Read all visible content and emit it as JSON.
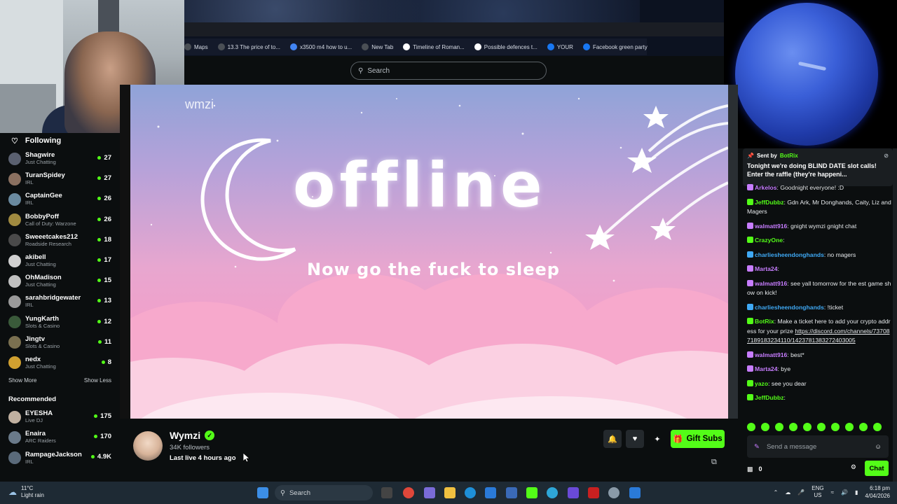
{
  "browser": {
    "bookmarks": [
      {
        "label": "Maps",
        "color": "#4a4f55"
      },
      {
        "label": "13.3 The price of to...",
        "color": "#4a4f55"
      },
      {
        "label": "x3500 m4 how to u...",
        "color": "#4285f4"
      },
      {
        "label": "New Tab",
        "color": "#4a4f55"
      },
      {
        "label": "Timeline of Roman...",
        "color": "#ffffff"
      },
      {
        "label": "Possible defences t...",
        "color": "#ffffff"
      },
      {
        "label": "YOUR",
        "color": "#1877f2"
      },
      {
        "label": "Facebook green party",
        "color": "#1877f2"
      }
    ]
  },
  "header": {
    "search_placeholder": "Search"
  },
  "sidebar": {
    "following_label": "Following",
    "channels": [
      {
        "name": "Shagwire",
        "category": "Just Chatting",
        "viewers": "27",
        "avatar": "#5a6070"
      },
      {
        "name": "TuranSpidey",
        "category": "IRL",
        "viewers": "27",
        "avatar": "#8a7060"
      },
      {
        "name": "CaptainGee",
        "category": "IRL",
        "viewers": "26",
        "avatar": "#6a8aa0"
      },
      {
        "name": "BobbyPoff",
        "category": "Call of Duty: Warzone",
        "viewers": "26",
        "avatar": "#a08a40"
      },
      {
        "name": "Sweeetcakes212",
        "category": "Roadside Research",
        "viewers": "18",
        "avatar": "#4a4a4a"
      },
      {
        "name": "akibell",
        "category": "Just Chatting",
        "viewers": "17",
        "avatar": "#d0d0d0"
      },
      {
        "name": "OhMadison",
        "category": "Just Chatting",
        "viewers": "15",
        "avatar": "#c0c0c0"
      },
      {
        "name": "sarahbridgewater",
        "category": "IRL",
        "viewers": "13",
        "avatar": "#9a9a9a"
      },
      {
        "name": "YungKarth",
        "category": "Slots & Casino",
        "viewers": "12",
        "avatar": "#3a5a3a"
      },
      {
        "name": "Jingtv",
        "category": "Slots & Casino",
        "viewers": "11",
        "avatar": "#7a7050"
      },
      {
        "name": "nedx",
        "category": "Just Chatting",
        "viewers": "8",
        "avatar": "#d0a030"
      }
    ],
    "show_more": "Show More",
    "show_less": "Show Less",
    "recommended_label": "Recommended",
    "recommended": [
      {
        "name": "EYESHA",
        "category": "Live DJ",
        "viewers": "175",
        "avatar": "#c0b0a0"
      },
      {
        "name": "Enaira",
        "category": "ARC Raiders",
        "viewers": "170",
        "avatar": "#6a7a8a"
      },
      {
        "name": "RampageJackson",
        "category": "IRL",
        "viewers": "4.9K",
        "avatar": "#5a6a7a"
      }
    ]
  },
  "player": {
    "watermark": "wmzi",
    "offline_word": "offline",
    "tagline": "Now go the fuck to sleep"
  },
  "channel": {
    "name": "Wymzi",
    "followers": "34K followers",
    "last_live": "Last live 4 hours ago",
    "gift_label": "Gift Subs"
  },
  "chat": {
    "pinned": {
      "sent_by_label": "Sent by",
      "sender": "BotRix",
      "message": "Tonight we're doing BLIND DATE slot calls! Enter the raffle (they're happeni..."
    },
    "messages": [
      {
        "user": "Arkelos",
        "color": "#c77dff",
        "text": "Goodnight everyone! :D"
      },
      {
        "user": "JeffDubbz",
        "color": "#53fc18",
        "text": "Gdn Ark, Mr Donghands, Caity, Liz and Magers"
      },
      {
        "user": "walmatt916",
        "color": "#c77dff",
        "text": "gnight wymzi gnight chat"
      },
      {
        "user": "CrazyOne",
        "color": "#53fc18",
        "text": ""
      },
      {
        "user": "charliesheendonghands",
        "color": "#3fa9f5",
        "text": "no magers"
      },
      {
        "user": "Marta24",
        "color": "#c77dff",
        "text": ""
      },
      {
        "user": "walmatt916",
        "color": "#c77dff",
        "text": "see yall tomorrow for the est game show on kick!"
      },
      {
        "user": "charliesheendonghands",
        "color": "#3fa9f5",
        "text": "!ticket"
      },
      {
        "user": "BotRix",
        "color": "#53fc18",
        "text": "Make a ticket here to add your crypto address for your prize",
        "link": "https://discord.com/channels/737087189183234110/1423781383272403005"
      },
      {
        "user": "walmatt916",
        "color": "#c77dff",
        "text": "best*"
      },
      {
        "user": "Marta24",
        "color": "#c77dff",
        "text": "bye"
      },
      {
        "user": "yazo",
        "color": "#53fc18",
        "text": "see you dear"
      },
      {
        "user": "JeffDubbz",
        "color": "#53fc18",
        "text": ""
      }
    ],
    "input_placeholder": "Send a message",
    "points": "0",
    "chat_button": "Chat"
  },
  "taskbar": {
    "weather_temp": "11°C",
    "weather_desc": "Light rain",
    "search_placeholder": "Search",
    "lang_top": "ENG",
    "lang_bottom": "US",
    "time": "6:18 pm",
    "date": "4/04/2026"
  },
  "colors": {
    "accent": "#53fc18",
    "bg": "#0b0e0f",
    "panel": "#1a1e21"
  }
}
